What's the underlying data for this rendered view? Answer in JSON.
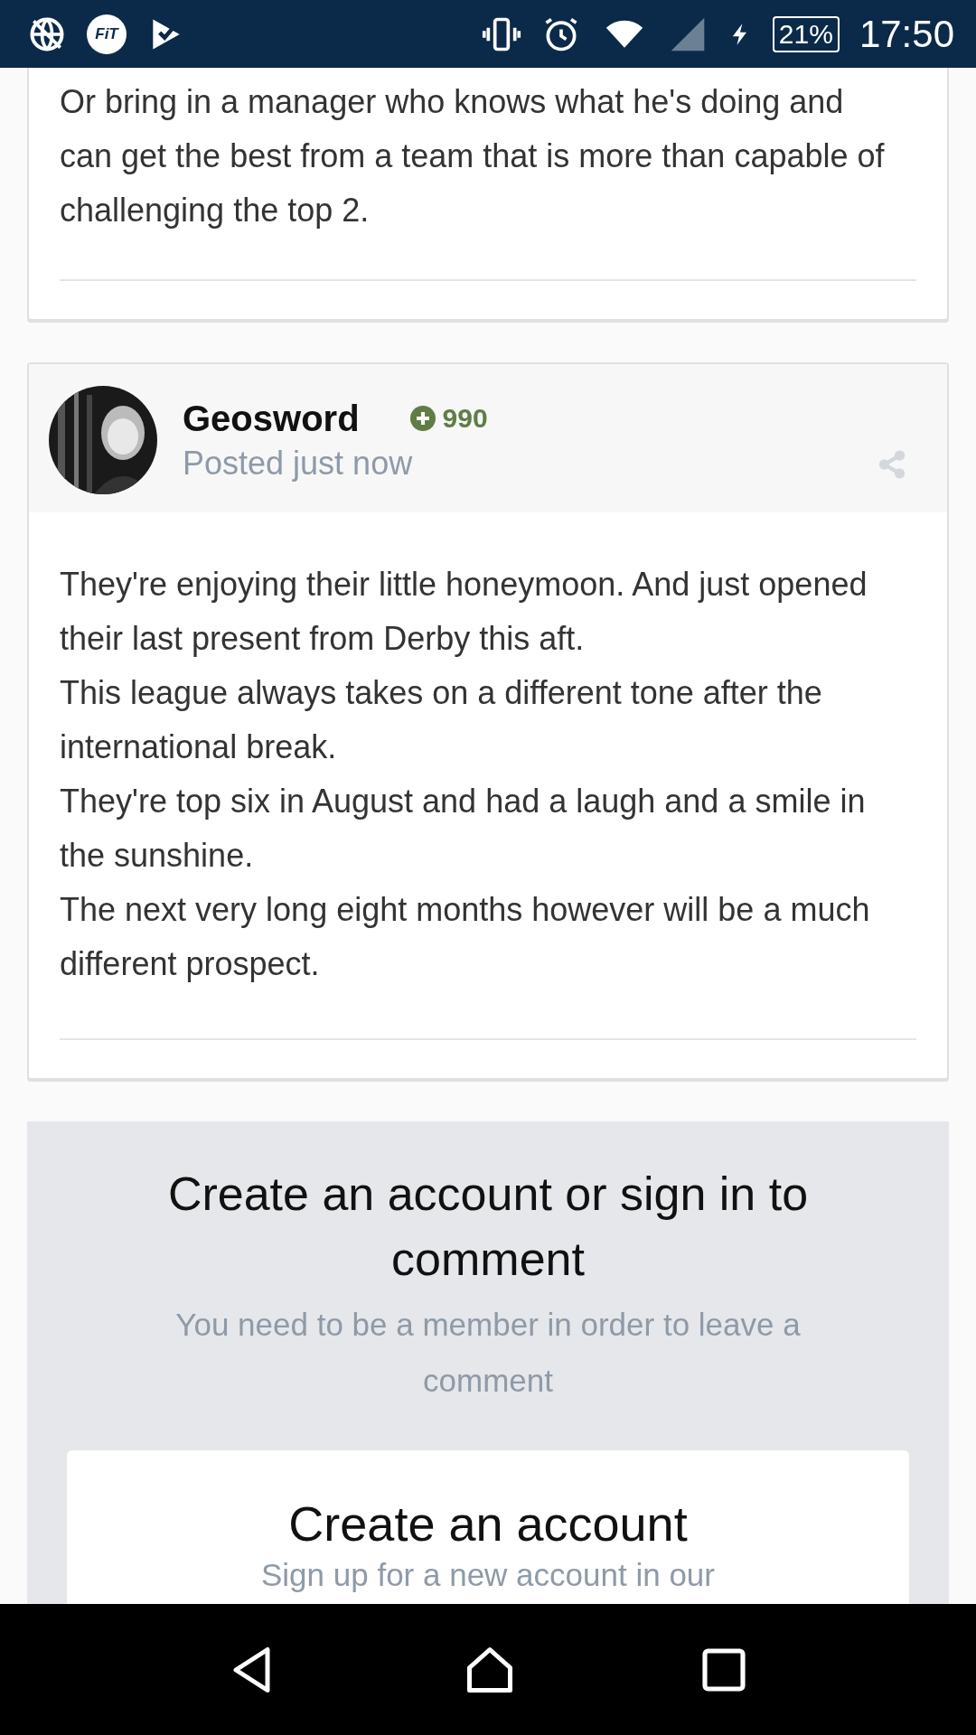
{
  "status_bar": {
    "fit_label": "FiT",
    "battery": "21%",
    "time": "17:50"
  },
  "posts": [
    {
      "paragraphs": [
        "Or bring in a manager who knows what he's doing and can get the best from a team that is more than capable of challenging the top 2."
      ]
    },
    {
      "author": "Geosword",
      "reputation": "990",
      "posted": "Posted just now",
      "paragraphs": [
        "They're enjoying their little honeymoon. And just opened their last present from Derby this aft.",
        "This league always takes on a different tone after the international break.",
        "They're top six in August and had a laugh and a smile in the sunshine.",
        "The next very long eight months however will be a much different prospect."
      ]
    }
  ],
  "signin": {
    "title": "Create an account or sign in to comment",
    "subtitle": "You need to be a member in order to leave a comment",
    "cards": [
      {
        "title": "Create an account",
        "subtitle": "Sign up for a new account in our"
      }
    ]
  }
}
